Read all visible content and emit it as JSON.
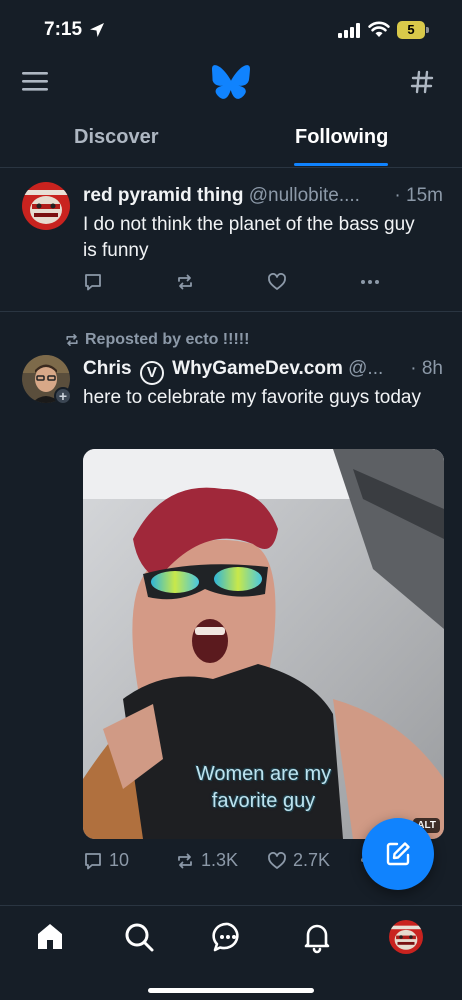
{
  "status_bar": {
    "time": "7:15",
    "battery": "5"
  },
  "top_bar": {
    "menu_icon": "hamburger-menu-icon",
    "logo_icon": "butterfly-logo-icon",
    "feeds_icon": "hashtag-icon"
  },
  "tabs": [
    {
      "label": "Discover",
      "active": false
    },
    {
      "label": "Following",
      "active": true
    }
  ],
  "colors": {
    "background": "#161e27",
    "accent": "#1083fe",
    "muted_text": "#8c99a8",
    "divider": "#2a3541"
  },
  "posts": [
    {
      "display_name": "red pyramid thing",
      "handle": "@nullobite....",
      "time": "· 15m",
      "text": "I do not think the planet of the bass guy is funny"
    },
    {
      "repost_label": "Reposted by ecto !!!!!",
      "display_name_first": "Chris",
      "verified_mark": "V",
      "display_name_rest": "WhyGameDev.com",
      "handle": "@...",
      "time": "· 8h",
      "text": "here to celebrate my favorite guys today",
      "media_caption_line1": "Women are my",
      "media_caption_line2": "favorite guy",
      "alt_badge": "ALT",
      "reply_count": "10",
      "repost_count": "1.3K",
      "like_count": "2.7K"
    }
  ],
  "bottom_nav": [
    "home-icon",
    "search-icon",
    "chat-icon",
    "bell-icon",
    "profile-avatar"
  ]
}
